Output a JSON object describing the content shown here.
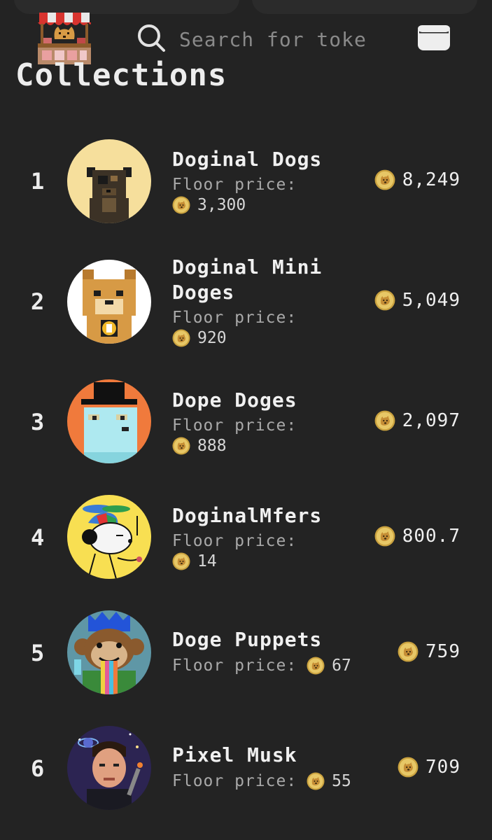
{
  "header": {
    "search": {
      "placeholder": "Search for toke"
    }
  },
  "page_title": "Collections",
  "collections": [
    {
      "rank": "1",
      "name": "Doginal Dogs",
      "floor_label": "Floor price:",
      "floor_value": "3,300",
      "volume": "8,249"
    },
    {
      "rank": "2",
      "name": "Doginal Mini Doges",
      "floor_label": "Floor price:",
      "floor_value": "920",
      "volume": "5,049"
    },
    {
      "rank": "3",
      "name": "Dope Doges",
      "floor_label": "Floor price:",
      "floor_value": "888",
      "volume": "2,097"
    },
    {
      "rank": "4",
      "name": "DoginalMfers",
      "floor_label": "Floor price:",
      "floor_value": "14",
      "volume": "800.7"
    },
    {
      "rank": "5",
      "name": "Doge Puppets",
      "floor_label": "Floor price:",
      "floor_value": "67",
      "volume": "759"
    },
    {
      "rank": "6",
      "name": "Pixel Musk",
      "floor_label": "Floor price:",
      "floor_value": "55",
      "volume": "709"
    }
  ],
  "icons": {
    "logo": "doge-market-stall-logo",
    "search": "search-icon",
    "wallet": "wallet-icon",
    "currency": "dogecoin-icon"
  },
  "colors": {
    "background": "#232323",
    "text": "#ececec",
    "muted": "#a9a9a9",
    "coin": "#d9b24a"
  }
}
